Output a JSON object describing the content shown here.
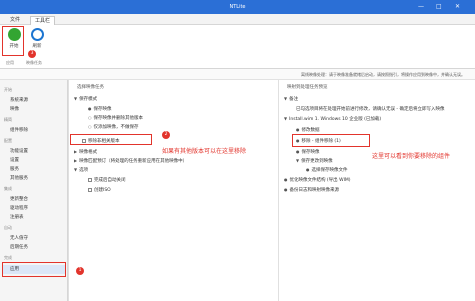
{
  "window": {
    "title": "NTLite"
  },
  "tabs": [
    "文件",
    "工具栏"
  ],
  "ribbon": {
    "buttons": [
      {
        "label": "开始",
        "icon": "play-icon",
        "color": "#33a532"
      },
      {
        "label": "刷新",
        "icon": "refresh-icon",
        "color": "#1c75d1"
      }
    ],
    "groups": [
      "应用",
      "映像任务"
    ]
  },
  "status_message": "离线映像处理：请于映像准备就绪后启动，请按照指引，将操作应用到映像中，并确认无误。",
  "sidebar": {
    "sections": [
      {
        "title": "开始",
        "items": [
          "系统来源",
          "映像"
        ]
      },
      {
        "title": "精简",
        "items": [
          "组件移除"
        ]
      },
      {
        "title": "配置",
        "items": [
          "功能设置",
          "设置",
          "服务",
          "其他服务"
        ]
      },
      {
        "title": "集成",
        "items": [
          "更新整合",
          "驱动程序",
          "注册表"
        ]
      },
      {
        "title": "自动",
        "items": [
          "无人值守",
          "后期任务"
        ]
      },
      {
        "title": "完成",
        "items": [
          "应用"
        ]
      }
    ],
    "active": "应用"
  },
  "middle": {
    "header": "选择映像任务",
    "nodes": [
      {
        "label": "保存模式",
        "level": 0,
        "type": "tree"
      },
      {
        "label": "保存映像",
        "level": 1,
        "type": "radio"
      },
      {
        "label": "保存映像并删除其他版本",
        "level": 1,
        "type": "radio"
      },
      {
        "label": "仅添加映像，不做保存",
        "level": 1,
        "type": "radio"
      },
      {
        "label": "移除非相关版本",
        "level": 0,
        "type": "check"
      },
      {
        "label": "映像格式",
        "level": 0,
        "type": "tree"
      },
      {
        "label": "映像匹配预订（将处理的任务重新应用在其他映像中）",
        "level": 0,
        "type": "tree"
      },
      {
        "label": "选项",
        "level": 0,
        "type": "tree"
      },
      {
        "label": "完成后自动关闭",
        "level": 1,
        "type": "check"
      },
      {
        "label": "创建ISO",
        "level": 1,
        "type": "check"
      }
    ]
  },
  "right": {
    "header": "映射到处理任务预览",
    "nodes": [
      {
        "label": "备注",
        "level": 0
      },
      {
        "label": "已勾选项目将在处理开始前进行修改，请确认无误 - 确定后将立即写入映像",
        "level": 1
      },
      {
        "label": "Install.wim 1. Windows 10 企业版 (已加载)",
        "level": 0
      },
      {
        "label": "修改数据",
        "level": 1
      },
      {
        "label": "移除 - 组件移除 (1)",
        "level": 1
      },
      {
        "label": "保存映像",
        "level": 1
      },
      {
        "label": "保存更改到映像",
        "level": 1
      },
      {
        "label": "选择保存映像文件",
        "level": 2
      },
      {
        "label": "优化映像文件结构 (导出 WIM)",
        "level": 0
      },
      {
        "label": "备份日志和映射映像来源",
        "level": 0
      }
    ]
  },
  "annotations": {
    "badges": [
      "1",
      "2",
      "3"
    ],
    "note_middle": "如果有其他版本可以在这里移除",
    "note_right": "这里可以看到你要移除的组件"
  },
  "colors": {
    "accent": "#2b6fd6",
    "annotation": "#e2342c"
  }
}
